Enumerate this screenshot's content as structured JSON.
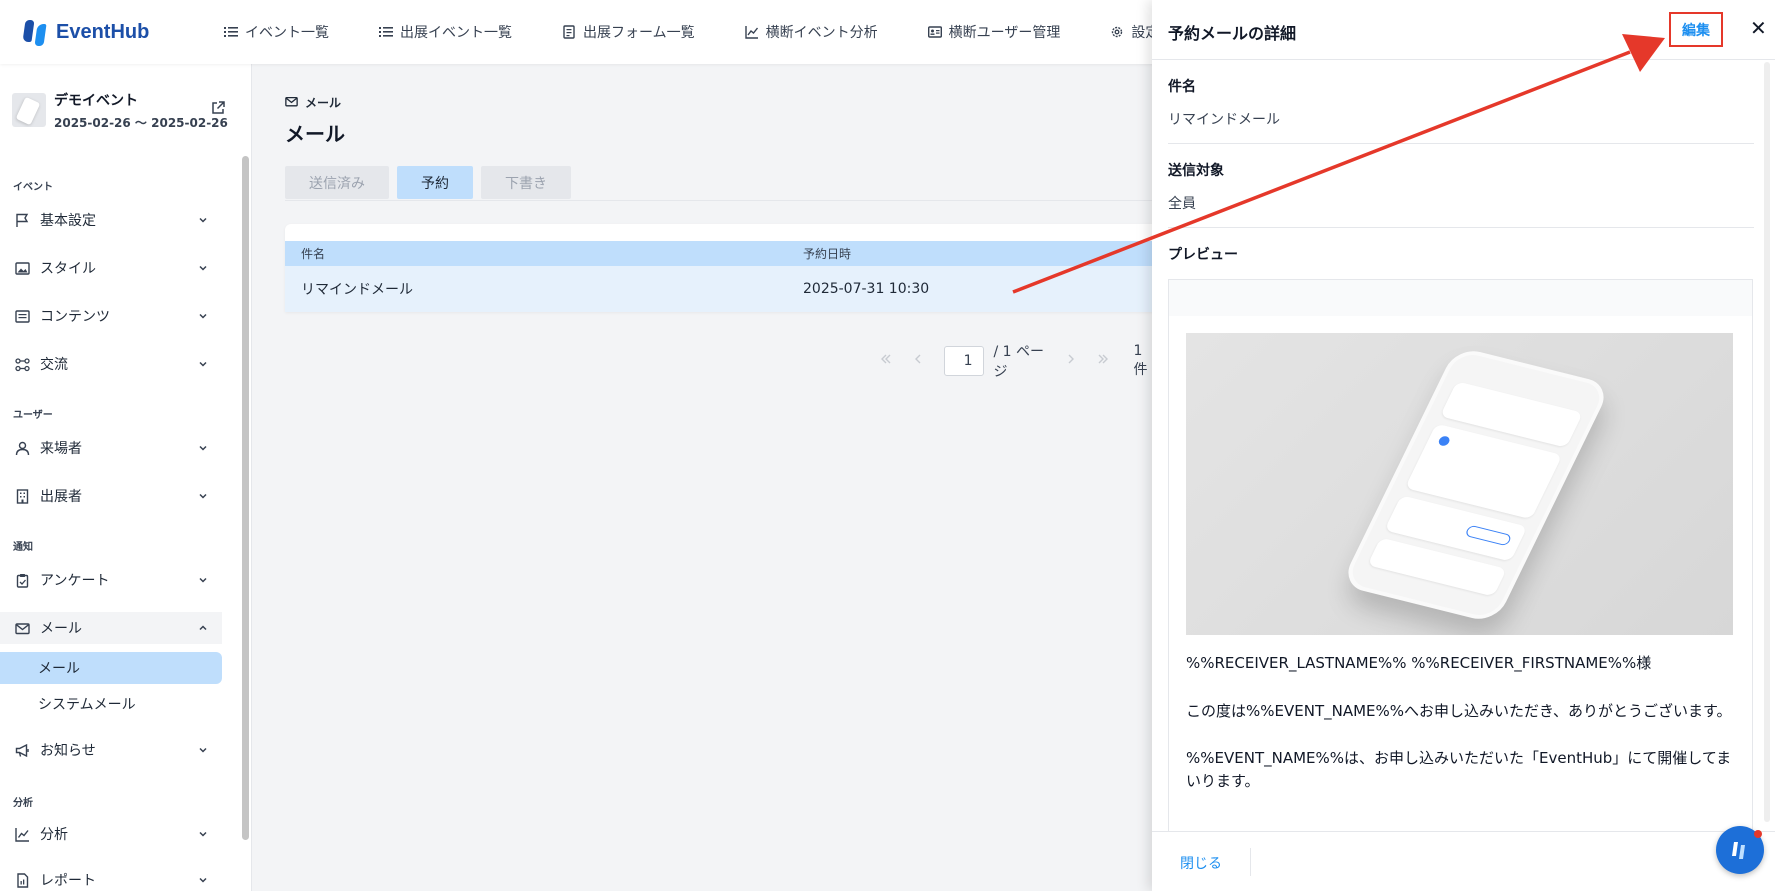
{
  "app": {
    "brand": "EventHub",
    "brand_color": "#1c4fa8",
    "accent_color": "#1d8ff0"
  },
  "topnav": {
    "items": [
      {
        "label": "イベント一覧",
        "icon": "list-icon"
      },
      {
        "label": "出展イベント一覧",
        "icon": "list-icon"
      },
      {
        "label": "出展フォーム一覧",
        "icon": "form-icon"
      },
      {
        "label": "横断イベント分析",
        "icon": "chart-icon"
      },
      {
        "label": "横断ユーザー管理",
        "icon": "id-card-icon"
      },
      {
        "label": "設定",
        "icon": "gear-icon"
      }
    ]
  },
  "sidebar": {
    "event": {
      "name": "デモイベント",
      "date": "2025-02-26 〜 2025-02-26"
    },
    "sections": {
      "event": "イベント",
      "user": "ユーザー",
      "notify": "通知",
      "analysis": "分析"
    },
    "items": {
      "basic": "基本設定",
      "style": "スタイル",
      "contents": "コンテンツ",
      "exchange": "交流",
      "visitors": "来場者",
      "exhibitors": "出展者",
      "survey": "アンケート",
      "mail": "メール",
      "mail_sub": "メール",
      "system_mail": "システムメール",
      "notice": "お知らせ",
      "analytics": "分析",
      "report": "レポート"
    }
  },
  "main": {
    "breadcrumb": "メール",
    "title": "メール",
    "tabs": [
      "送信済み",
      "予約",
      "下書き"
    ],
    "active_tab": "予約",
    "table": {
      "headers": [
        "件名",
        "予約日時"
      ],
      "rows": [
        {
          "subject": "リマインドメール",
          "datetime": "2025-07-31 10:30"
        }
      ]
    },
    "pager": {
      "page": "1",
      "total": "/ 1 ページ",
      "count": "1件"
    }
  },
  "drawer": {
    "title": "予約メールの詳細",
    "edit_label": "編集",
    "close_x": "✕",
    "fields": {
      "subject_label": "件名",
      "subject_value": "リマインドメール",
      "target_label": "送信対象",
      "target_value": "全員",
      "preview_label": "プレビュー"
    },
    "preview": {
      "greeting": "%%RECEIVER_LASTNAME%% %%RECEIVER_FIRSTNAME%%様",
      "line1": "この度は%%EVENT_NAME%%へお申し込みいただき、ありがとうございます。",
      "line2": "%%EVENT_NAME%%は、お申し込みいただいた「EventHub」にて開催してまいります。"
    },
    "close_label": "閉じる"
  },
  "annotation": {
    "color": "#e5382a"
  }
}
